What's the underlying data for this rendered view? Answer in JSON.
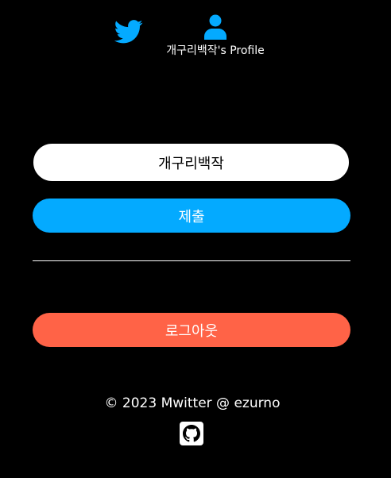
{
  "nav": {
    "home_icon": "twitter-icon",
    "profile_icon": "user-icon",
    "profile_label": "개구리백작's Profile",
    "accent_color": "#04aaff"
  },
  "profile_form": {
    "display_name_value": "개구리백작",
    "submit_label": "제출",
    "submit_color": "#04aaff"
  },
  "actions": {
    "logout_label": "로그아웃",
    "logout_color": "#ff6347"
  },
  "footer": {
    "copyright": "© 2023 Mwitter @ ezurno",
    "github_icon": "github-icon"
  }
}
